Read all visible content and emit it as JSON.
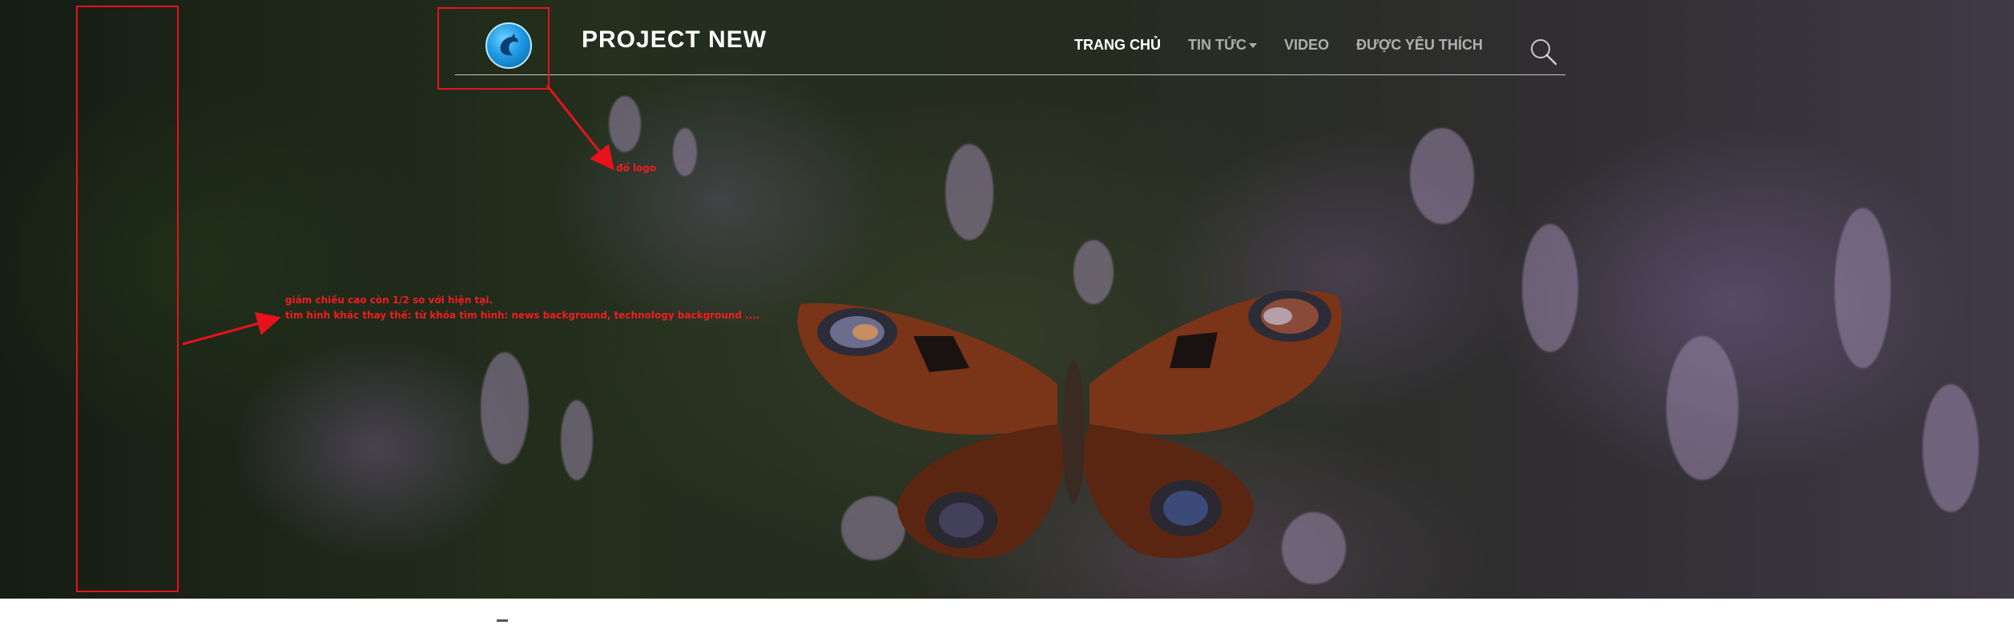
{
  "header": {
    "brand": "PROJECT NEW",
    "logo_icon": "dolphin-icon"
  },
  "nav": {
    "items": [
      {
        "label": "TRANG CHỦ",
        "active": true
      },
      {
        "label": "TIN TỨC",
        "active": false,
        "has_dropdown": true
      },
      {
        "label": "VIDEO",
        "active": false
      },
      {
        "label": "ĐƯỢC YÊU THÍCH",
        "active": false
      }
    ],
    "search_icon": "search-icon"
  },
  "hero": {
    "image_subject": "butterfly on heather flowers"
  },
  "annotations": {
    "logo_note": "đổ logo",
    "hero_note_line1": "giảm chiều cao còn 1/2 so với hiện tại.",
    "hero_note_line2": "tìm hình khác thay thế: từ khóa tìm hình: news background, technology background ....",
    "color": "#e8121b"
  },
  "colors": {
    "nav_active": "#ffffff",
    "nav_inactive": "#b8b8b8",
    "annotation": "#e8121b"
  }
}
